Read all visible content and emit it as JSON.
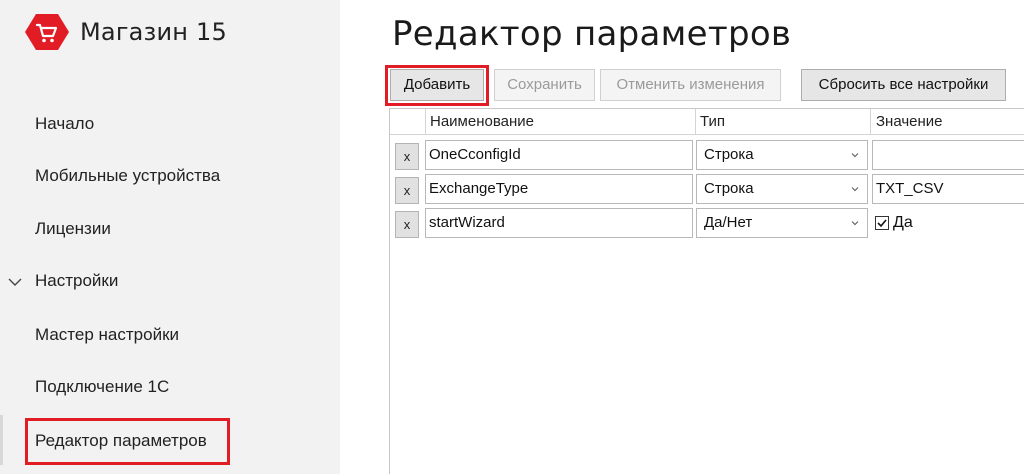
{
  "app": {
    "brand_name": "Магазин 15",
    "brand_color": "#e21c24"
  },
  "sidebar": {
    "items": [
      {
        "label": "Начало"
      },
      {
        "label": "Мобильные устройства"
      },
      {
        "label": "Лицензии"
      },
      {
        "label": "Настройки",
        "expanded": true
      },
      {
        "label": "Мастер настройки"
      },
      {
        "label": "Подключение 1С"
      },
      {
        "label": "Редактор параметров",
        "active": true
      }
    ]
  },
  "page": {
    "title": "Редактор параметров"
  },
  "toolbar": {
    "add_label": "Добавить",
    "save_label": "Сохранить",
    "cancel_label": "Отменить изменения",
    "reset_label": "Сбросить все настройки"
  },
  "grid": {
    "columns": [
      "Наименование",
      "Тип",
      "Значение"
    ],
    "rows": [
      {
        "remove": "x",
        "name": "OneCconfigId",
        "type": "Строка",
        "value": ""
      },
      {
        "remove": "x",
        "name": "ExchangeType",
        "type": "Строка",
        "value": "TXT_CSV"
      },
      {
        "remove": "x",
        "name": "startWizard",
        "type": "Да/Нет",
        "value_checked": true,
        "value_label": "Да"
      }
    ]
  },
  "icons": {
    "logo": "shopping-cart-icon",
    "expand": "chevron-down-icon",
    "dropdown": "chevron-down-icon",
    "check": "check-icon"
  }
}
